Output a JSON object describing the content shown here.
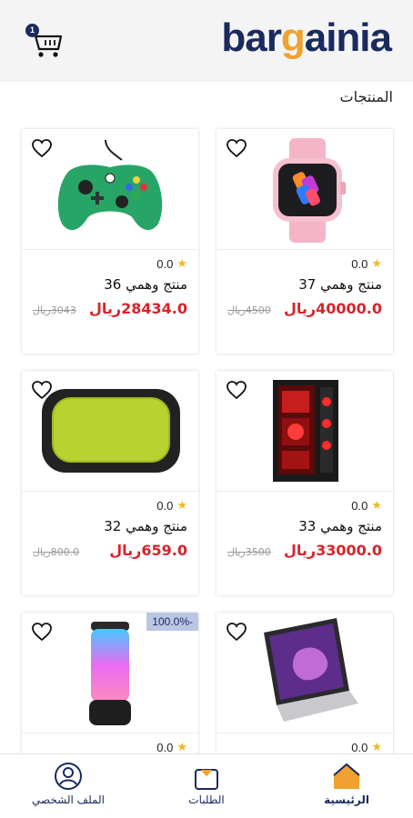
{
  "colors": {
    "brand_navy": "#1a2a5e",
    "brand_orange": "#f0a230",
    "price_red": "#d8232a",
    "star": "#f2b827"
  },
  "header": {
    "logo_part1": "bar",
    "logo_accent": "g",
    "logo_part2": "ainia",
    "cart_count": "1",
    "cart_icon": "cart-icon"
  },
  "section_title": "المنتجات",
  "products": [
    {
      "name": "منتج وهمي 37",
      "rating": "0.0",
      "price": "40000.0ريال",
      "old_price": "4500ريال",
      "image": "smartwatch"
    },
    {
      "name": "منتج وهمي 36",
      "rating": "0.0",
      "price": "28434.0ريال",
      "old_price": "3043ريال",
      "image": "game-controller"
    },
    {
      "name": "منتج وهمي 33",
      "rating": "0.0",
      "price": "33000.0ريال",
      "old_price": "3500ريال",
      "image": "pc-tower"
    },
    {
      "name": "منتج وهمي 32",
      "rating": "0.0",
      "price": "659.0ريال",
      "old_price": "800.0ريال",
      "image": "speaker"
    },
    {
      "name": "",
      "rating": "0.0",
      "price": "",
      "old_price": "",
      "image": "laptop"
    },
    {
      "name": "",
      "rating": "0.0",
      "price": "",
      "old_price": "",
      "image": "led-speaker",
      "discount": "100.0%-"
    }
  ],
  "bottom_nav": {
    "home": "الرئيسية",
    "orders": "الطلبات",
    "profile": "الملف الشخصي"
  }
}
